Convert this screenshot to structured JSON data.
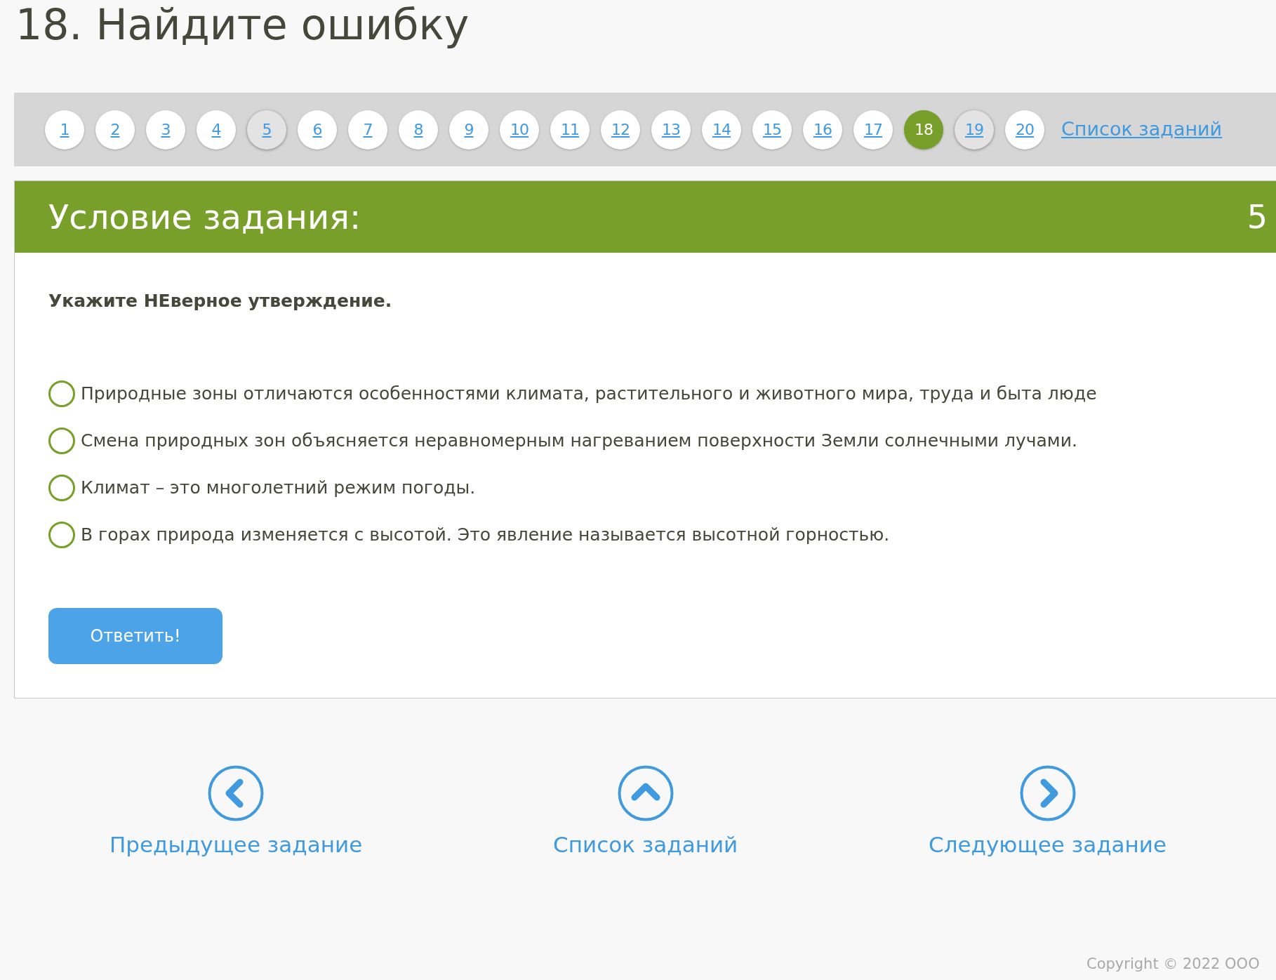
{
  "page_title": "18. Найдите ошибку",
  "task_nav": {
    "pages": [
      {
        "label": "1",
        "selected": false,
        "visited": false
      },
      {
        "label": "2",
        "selected": false,
        "visited": false
      },
      {
        "label": "3",
        "selected": false,
        "visited": false
      },
      {
        "label": "4",
        "selected": false,
        "visited": false
      },
      {
        "label": "5",
        "selected": false,
        "visited": true
      },
      {
        "label": "6",
        "selected": false,
        "visited": false
      },
      {
        "label": "7",
        "selected": false,
        "visited": false
      },
      {
        "label": "8",
        "selected": false,
        "visited": false
      },
      {
        "label": "9",
        "selected": false,
        "visited": false
      },
      {
        "label": "10",
        "selected": false,
        "visited": false
      },
      {
        "label": "11",
        "selected": false,
        "visited": false
      },
      {
        "label": "12",
        "selected": false,
        "visited": false
      },
      {
        "label": "13",
        "selected": false,
        "visited": false
      },
      {
        "label": "14",
        "selected": false,
        "visited": false
      },
      {
        "label": "15",
        "selected": false,
        "visited": false
      },
      {
        "label": "16",
        "selected": false,
        "visited": false
      },
      {
        "label": "17",
        "selected": false,
        "visited": false
      },
      {
        "label": "18",
        "selected": true,
        "visited": false
      },
      {
        "label": "19",
        "selected": false,
        "visited": true
      },
      {
        "label": "20",
        "selected": false,
        "visited": false
      }
    ],
    "list_link": "Список заданий"
  },
  "task_card": {
    "header": "Условие задания:",
    "points": "5",
    "question": "Укажите НЕверное утверждение.",
    "options": [
      {
        "text": "Природные зоны отличаются особенностями климата, растительного и животного мира, труда и быта люде",
        "checked": false
      },
      {
        "text": "Смена природных зон объясняется неравномерным нагреванием поверхности Земли солнечными лучами.",
        "checked": false
      },
      {
        "text": "Климат – это многолетний режим погоды.",
        "checked": false
      },
      {
        "text": "В горах природа изменяется с высотой. Это явление называется высотной горностью.",
        "checked": false
      }
    ],
    "submit_button": "Ответить!"
  },
  "bottom_nav": [
    {
      "kind": "prev",
      "label": "Предыдущее задание"
    },
    {
      "kind": "up",
      "label": "Список заданий"
    },
    {
      "kind": "next",
      "label": "Следующее задание"
    }
  ],
  "copyright": "Copyright © 2022 ООО"
}
